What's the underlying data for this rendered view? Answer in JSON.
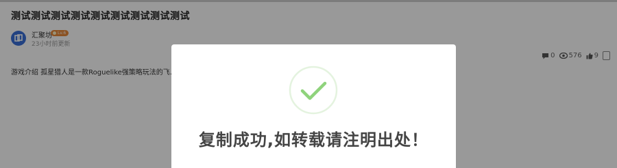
{
  "post": {
    "title": "测试测试测试测试测试测试测试测试测试",
    "author": "汇聚坊",
    "level": "Lv.6",
    "update_time": "23小时前更新",
    "summary": "游戏介绍 孤星猎人是一款Roguelike强策略玩法的飞……独特的方式赢得战斗，收获悬赏奖励与假期时光。寻找宇宙…",
    "stats": {
      "comments": "0",
      "views": "576",
      "likes": "9"
    }
  },
  "toast": {
    "message": "复制成功,如转载请注明出处！"
  },
  "colors": {
    "accent_green": "#8fd37c",
    "overlay": "rgba(0,0,0,0.4)",
    "avatar_blue": "#3a6fd8",
    "badge_orange": "#e8893a"
  },
  "icons": {
    "comment": "comment-icon",
    "view": "eye-icon",
    "like": "thumbs-up-icon",
    "favorite": "bookmark-icon",
    "success": "checkmark-circle-icon"
  }
}
